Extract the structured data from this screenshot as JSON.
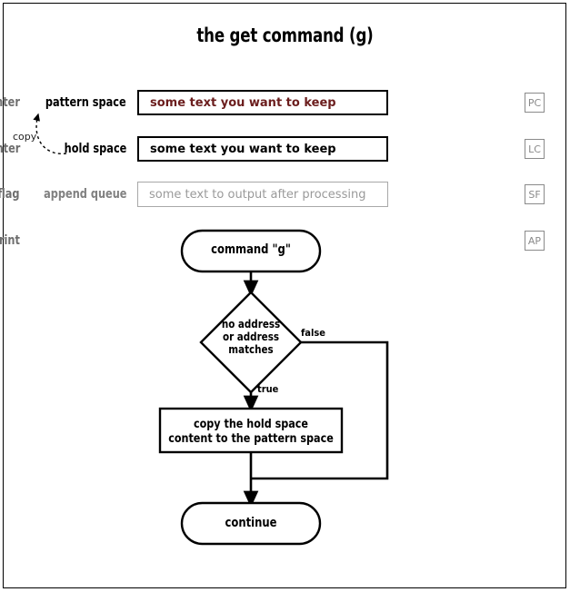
{
  "title": "the get command (g)",
  "registers_left": [
    {
      "label": "pattern space",
      "value": "some text you want to keep",
      "style": "pattern",
      "label_muted": false
    },
    {
      "label": "hold space",
      "value": "some text you want to keep",
      "style": "hold",
      "label_muted": false
    },
    {
      "label": "append queue",
      "value": "some text to output after processing",
      "style": "empty",
      "label_muted": true
    }
  ],
  "registers_right": [
    {
      "label": "program counter",
      "abbr": "PC"
    },
    {
      "label": "line counter",
      "abbr": "LC"
    },
    {
      "label": "substitution flag",
      "abbr": "SF"
    },
    {
      "label": "auto-print",
      "abbr": "AP"
    }
  ],
  "copy_annotation": {
    "label": "copy"
  },
  "flowchart": {
    "nodes": {
      "start": "command \"g\"",
      "decision_line1": "no address",
      "decision_line2": "or address",
      "decision_line3": "matches",
      "process_line1": "copy the hold space",
      "process_line2": "content to the pattern space",
      "end": "continue"
    },
    "edges": {
      "false_label": "false",
      "true_label": "true"
    }
  },
  "colors": {
    "pattern_text": "#6b1d1d",
    "muted": "#808080",
    "register_box_gray": "#a8a8a8",
    "stroke": "#000000",
    "background": "#ffffff"
  }
}
